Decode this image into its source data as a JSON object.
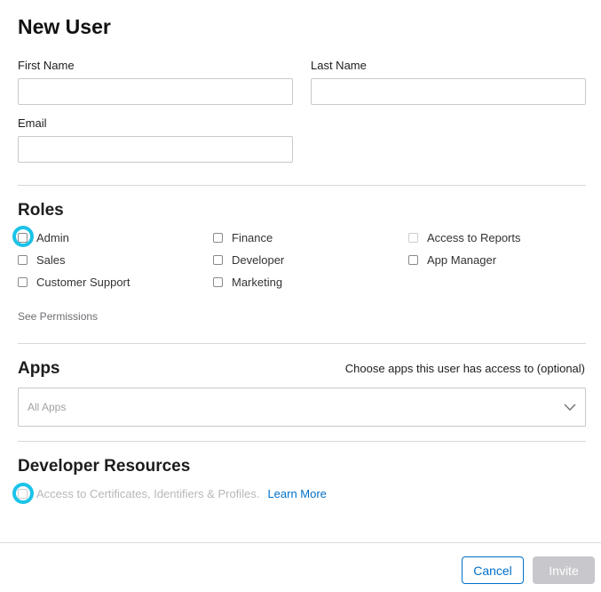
{
  "page": {
    "title": "New User"
  },
  "form": {
    "first_name": {
      "label": "First Name",
      "value": ""
    },
    "last_name": {
      "label": "Last Name",
      "value": ""
    },
    "email": {
      "label": "Email",
      "value": ""
    }
  },
  "roles": {
    "title": "Roles",
    "items": [
      {
        "label": "Admin",
        "checked": false,
        "disabled": false
      },
      {
        "label": "Finance",
        "checked": false,
        "disabled": false
      },
      {
        "label": "Access to Reports",
        "checked": false,
        "disabled": true
      },
      {
        "label": "Sales",
        "checked": false,
        "disabled": false
      },
      {
        "label": "Developer",
        "checked": false,
        "disabled": false
      },
      {
        "label": "App Manager",
        "checked": false,
        "disabled": false
      },
      {
        "label": "Customer Support",
        "checked": false,
        "disabled": false
      },
      {
        "label": "Marketing",
        "checked": false,
        "disabled": false
      }
    ],
    "see_permissions": "See Permissions"
  },
  "apps": {
    "title": "Apps",
    "hint": "Choose apps this user has access to (optional)",
    "select_placeholder": "All Apps"
  },
  "developer_resources": {
    "title": "Developer Resources",
    "certificates_label": "Access to Certificates, Identifiers & Profiles.",
    "certificates_disabled": true,
    "learn_more": "Learn More"
  },
  "footer": {
    "cancel_label": "Cancel",
    "invite_label": "Invite",
    "invite_disabled": true
  },
  "colors": {
    "accent": "#0070c9",
    "highlight": "#1cc3e8",
    "disabled_button": "#c7c7cc"
  }
}
